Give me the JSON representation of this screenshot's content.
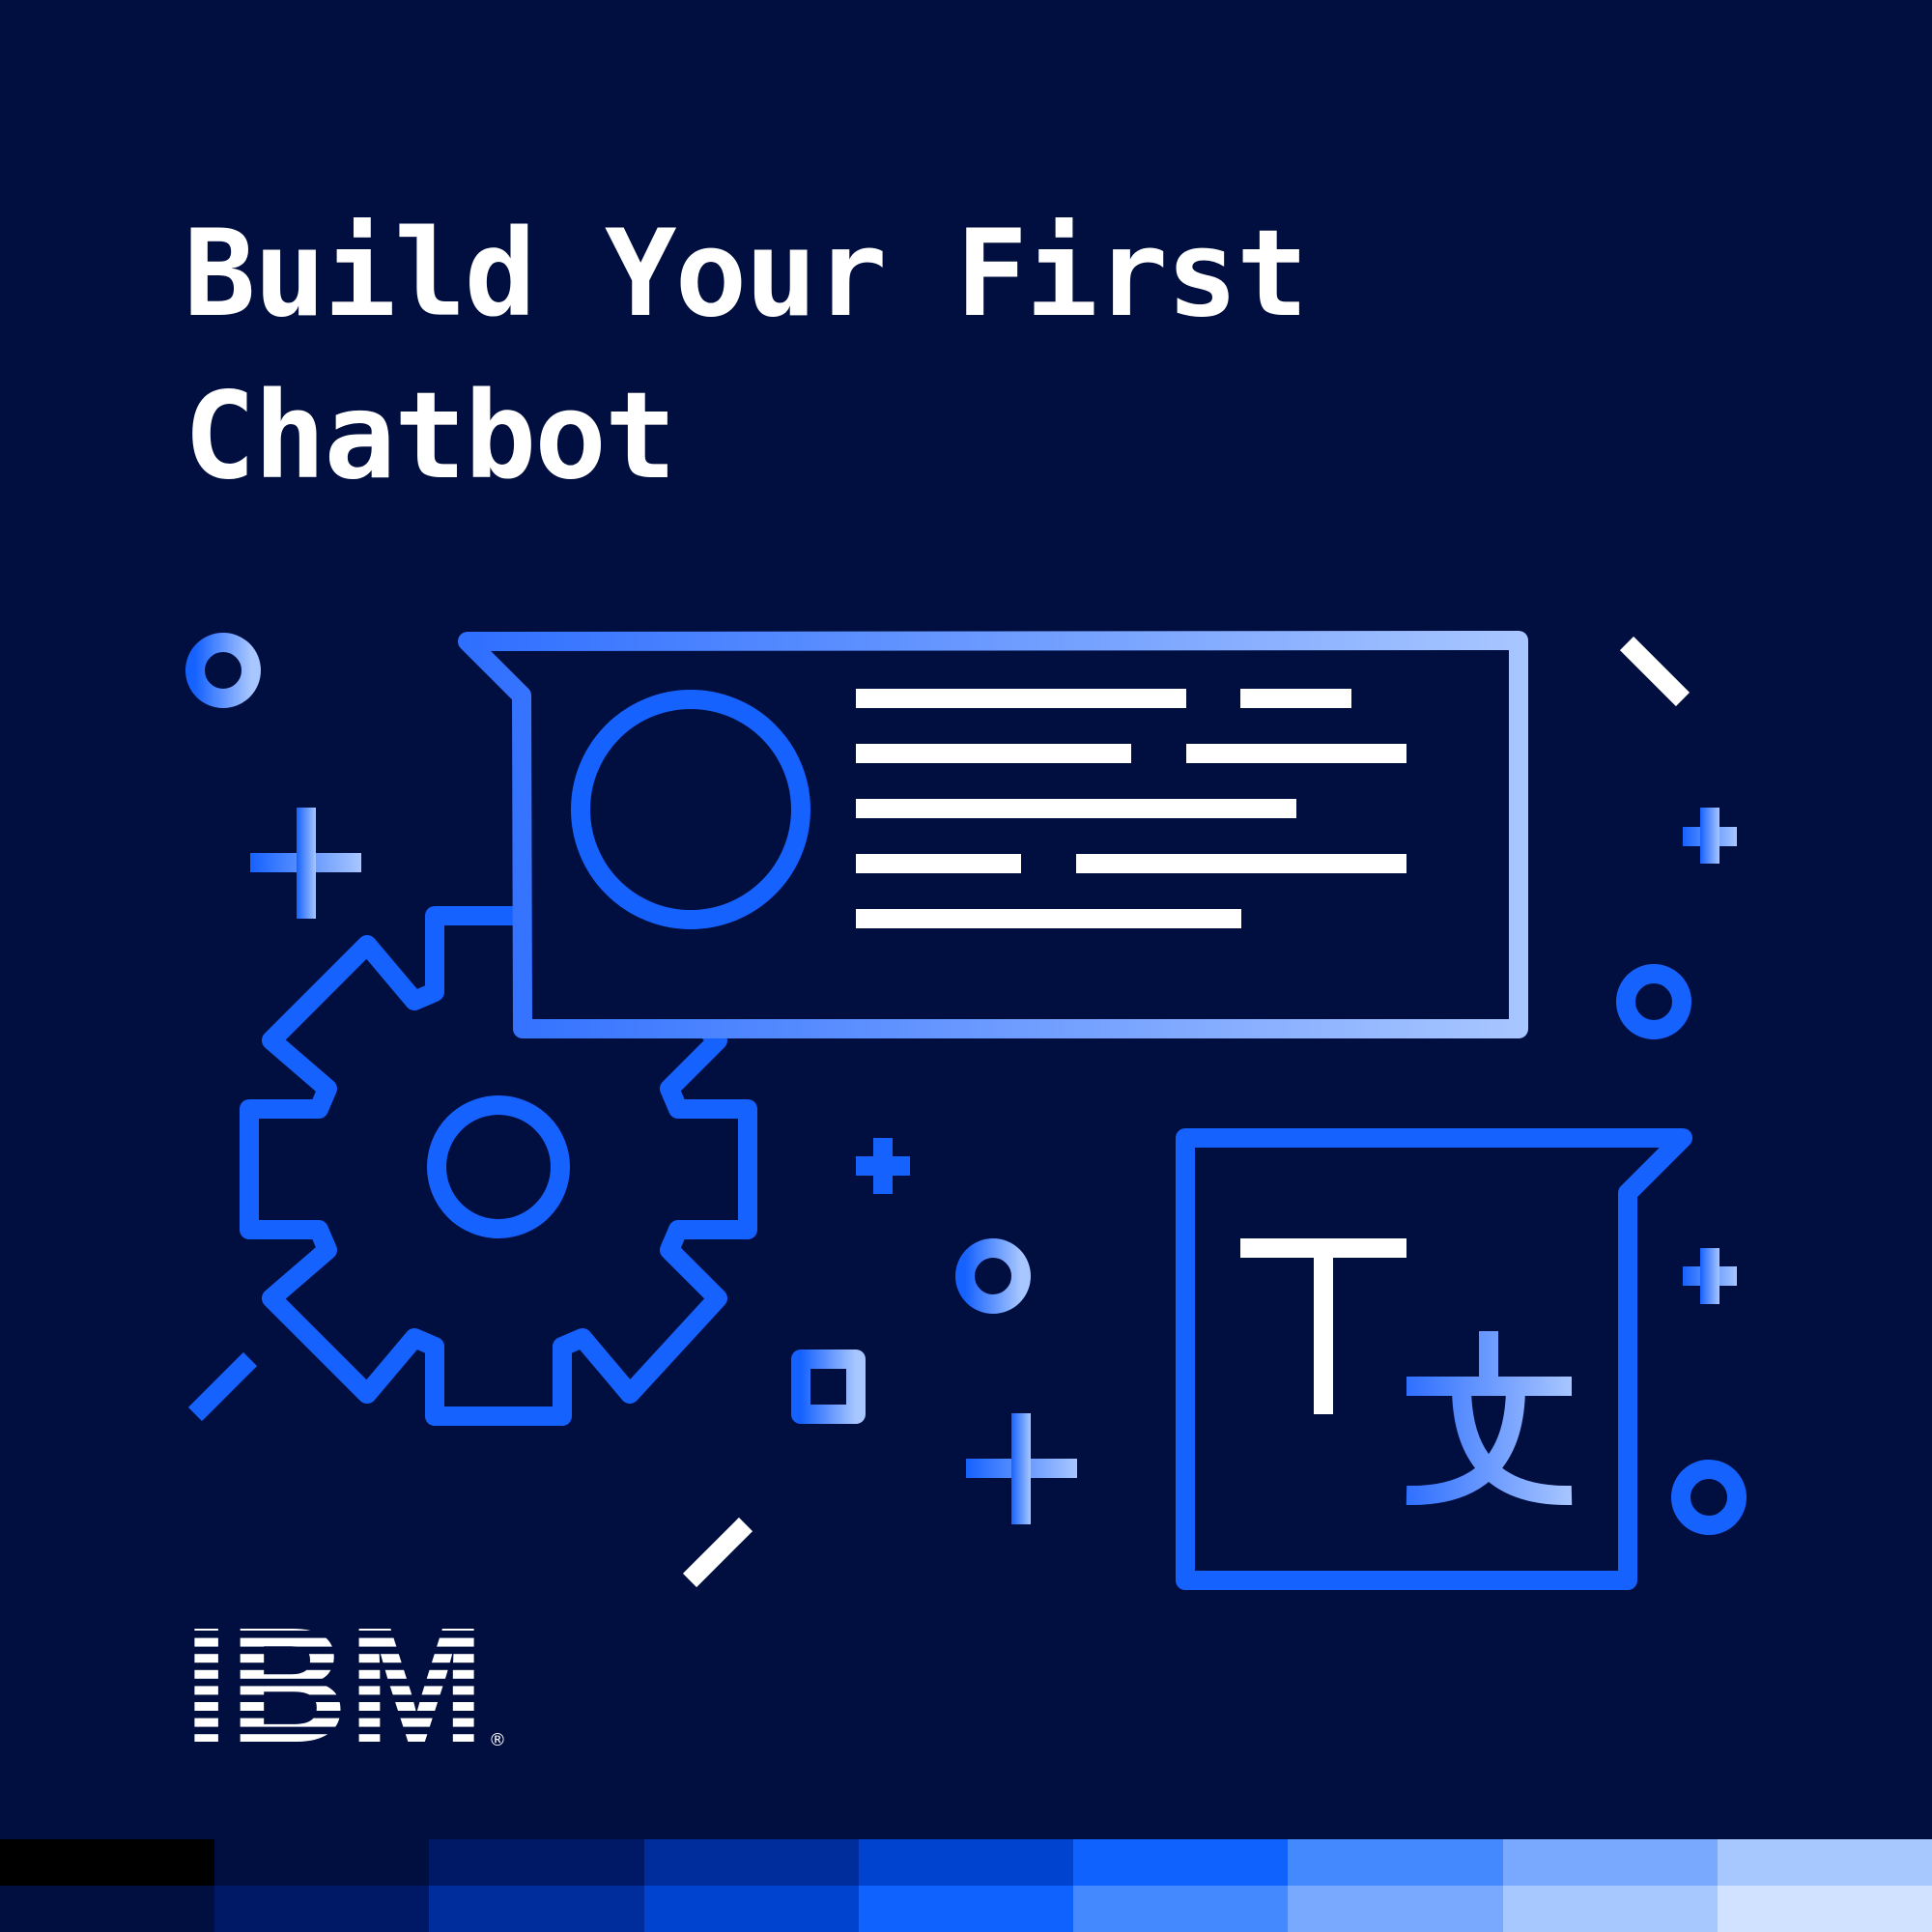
{
  "title": {
    "line1": "Build Your First",
    "line2": "Chatbot"
  },
  "logo": {
    "text": "IBM",
    "mark": "®"
  },
  "colors": {
    "background": "#000f3f",
    "blue": "#1662ff",
    "light_blue": "#a8c6ff",
    "white": "#ffffff"
  },
  "palette": {
    "top": [
      "#000000",
      "#000f3f",
      "#001966",
      "#002d9c",
      "#0043ce",
      "#0f62fe",
      "#4589ff",
      "#78a9ff",
      "#a6c8ff"
    ],
    "bottom": [
      "#000f3f",
      "#001966",
      "#002d9c",
      "#0043ce",
      "#0f62fe",
      "#4589ff",
      "#78a9ff",
      "#a6c8ff",
      "#d0e2ff"
    ]
  },
  "icons": {
    "chat_bubble": "chat-bubble-icon",
    "gear": "gear-icon",
    "translate": "translate-icon"
  }
}
